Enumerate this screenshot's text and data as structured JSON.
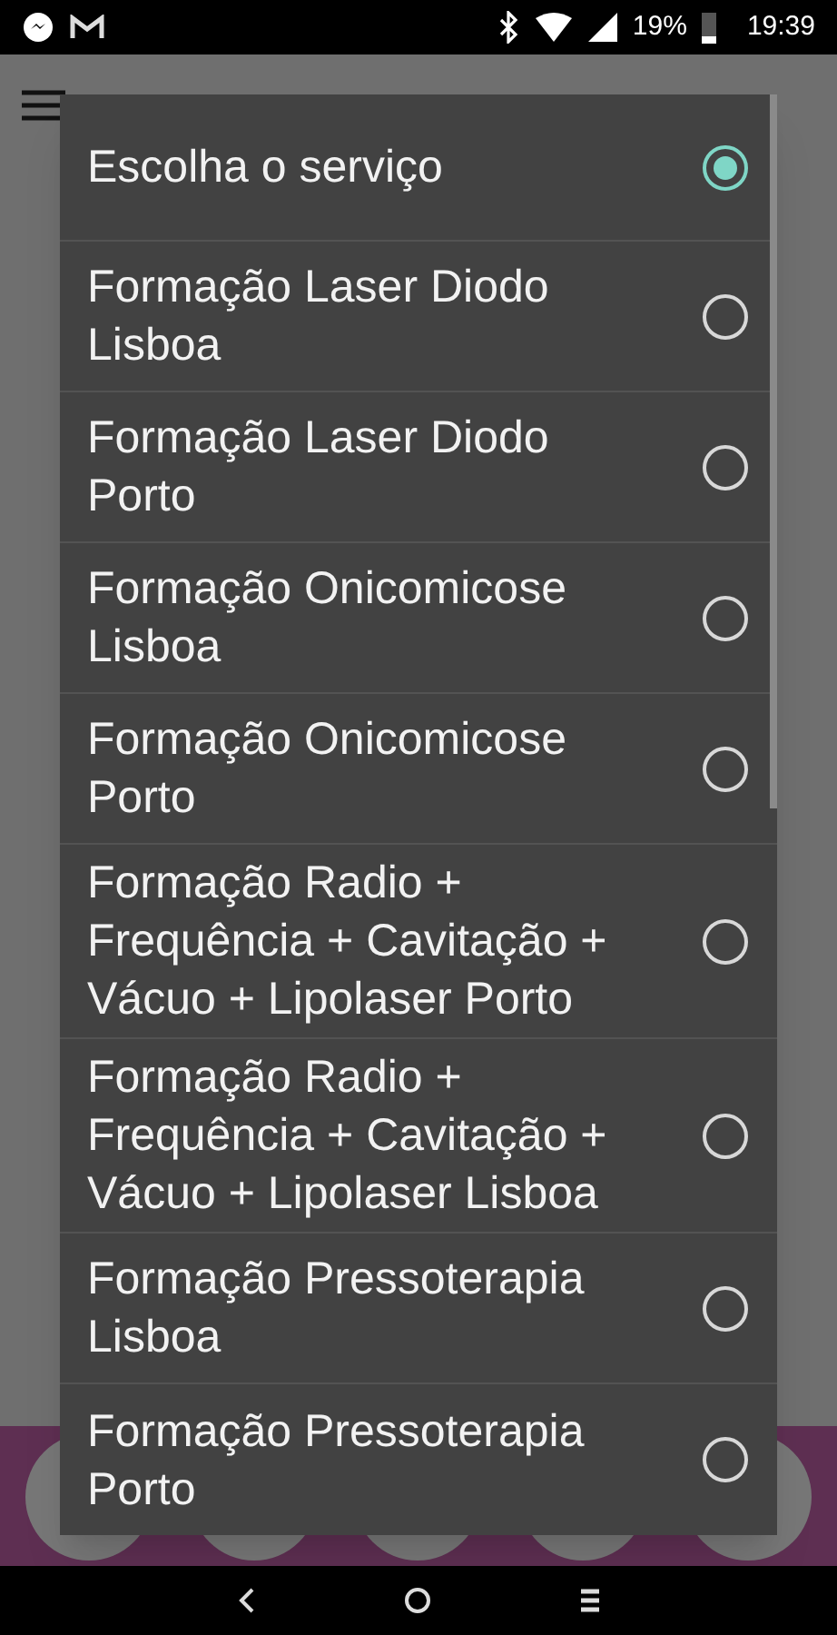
{
  "status_bar": {
    "battery": "19%",
    "time": "19:39"
  },
  "dialog": {
    "options": [
      {
        "label": "Escolha o serviço",
        "selected": true
      },
      {
        "label": "Formação Laser Diodo Lisboa",
        "selected": false
      },
      {
        "label": "Formação Laser Diodo Porto",
        "selected": false
      },
      {
        "label": "Formação Onicomicose Lisboa",
        "selected": false
      },
      {
        "label": "Formação Onicomicose Porto",
        "selected": false
      },
      {
        "label": "Formação Radio + Frequência + Cavitação + Vácuo + Lipolaser Porto",
        "selected": false
      },
      {
        "label": "Formação Radio + Frequência + Cavitação + Vácuo + Lipolaser Lisboa",
        "selected": false
      },
      {
        "label": "Formação Pressoterapia Lisboa",
        "selected": false
      },
      {
        "label": "Formação Pressoterapia Porto",
        "selected": false
      }
    ]
  }
}
